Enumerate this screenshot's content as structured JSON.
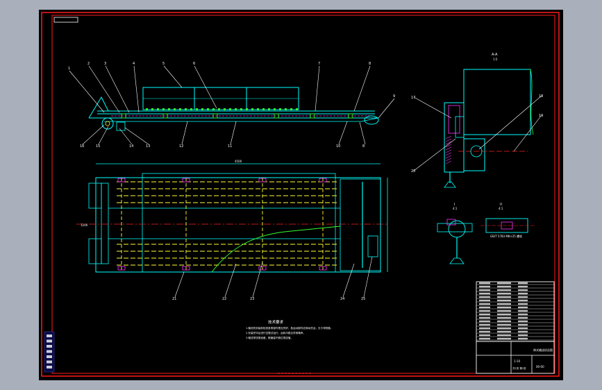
{
  "window": {
    "background": "#a9b0bc",
    "sheet_background": "#000000",
    "frame_color": "#ff1a1a"
  },
  "colors": {
    "outline": "#00ffff",
    "magenta": "#ff33ff",
    "yellow": "#ffff33",
    "green": "#33ff33",
    "red": "#ff2020",
    "white": "#ffffff"
  },
  "labels": {
    "top_leaders": [
      "1",
      "2",
      "3",
      "4",
      "5",
      "6",
      "7",
      "8",
      "9"
    ],
    "bottom_leaders_front": [
      "16",
      "15",
      "14",
      "13",
      "12",
      "11",
      "10",
      "8"
    ],
    "bottom_leaders_plan": [
      "21",
      "22",
      "23",
      "24",
      "25"
    ],
    "section_right": [
      "17",
      "18",
      "19",
      "20"
    ],
    "view_a_title": "A-A",
    "view_a_scale": "1:5",
    "view_b_title": "I",
    "view_b_scale": "4:1",
    "view_c_title": "II",
    "view_c_scale": "4:1",
    "part_note": "GB/T 5783 M8×25 螺栓",
    "plan_top_dim": "4500",
    "plan_side_dim": "1200"
  },
  "notes": {
    "heading": "技术要求",
    "lines": [
      "1.输送机安装前检查各零部件是否完好，各运动部件应转动灵活，无卡滞现象。",
      "2.安装完毕后进行空载试运行，运转平稳无异常噪声。",
      "3.输送带张紧适度，跑偏量不超过规定值。"
    ]
  },
  "title_block": {
    "drawing_name": "带式输送机总图",
    "drawing_no": "00-00",
    "scale": "1:10",
    "sheet": "共1张 第1张"
  },
  "toolbar": {
    "items": [
      "layer-icon",
      "line-icon",
      "circle-icon",
      "text-icon",
      "dim-icon",
      "hatch-icon",
      "block-icon"
    ]
  }
}
